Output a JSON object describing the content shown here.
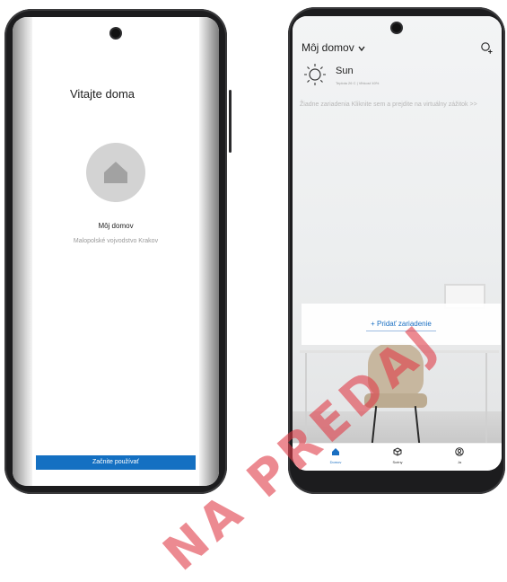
{
  "left_screen": {
    "welcome_title": "Vitajte doma",
    "home_name": "Môj domov",
    "home_location": "Malopolské vojvodstvo Krakov",
    "start_button": "Začnite používať"
  },
  "right_screen": {
    "home_selector": "Môj domov",
    "weather": {
      "condition": "Sun",
      "details": "Teplota 26 C | Vlhkosť 40%"
    },
    "empty_hint": "Žiadne zariadenia Kliknite sem a prejdite na virtuálny zážitok >>",
    "add_device": "+ Pridať zariadenie",
    "tabs": [
      {
        "label": "Domov",
        "icon": "home-icon",
        "active": true
      },
      {
        "label": "Scény",
        "icon": "scene-icon",
        "active": false
      },
      {
        "label": "Ja",
        "icon": "profile-icon",
        "active": false
      }
    ]
  },
  "watermark": "NA PREDAJ",
  "colors": {
    "accent": "#1a6fc2",
    "start_button": "#1470c2",
    "watermark": "#e03c48",
    "phone_frame": "#1c1c1e"
  }
}
